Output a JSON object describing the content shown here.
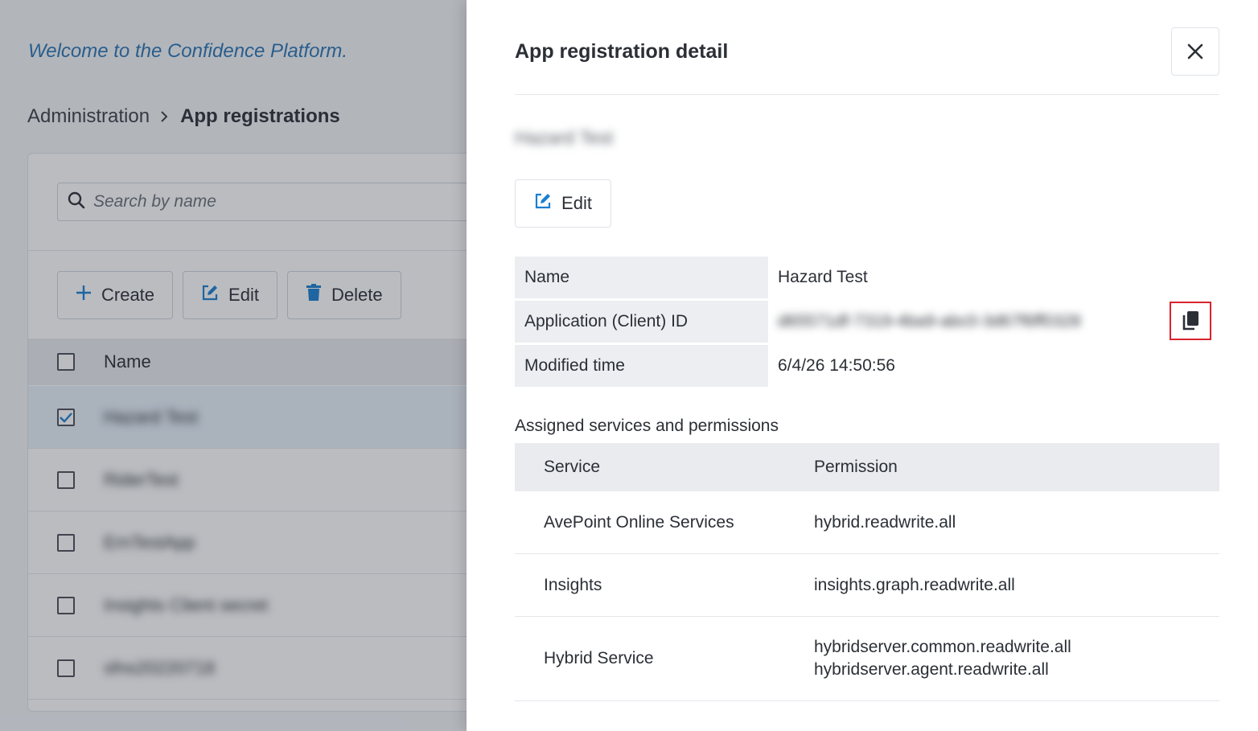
{
  "welcome": "Welcome to the Confidence Platform.",
  "breadcrumb": {
    "parent": "Administration",
    "current": "App registrations"
  },
  "search": {
    "placeholder": "Search by name"
  },
  "toolbar": {
    "create": "Create",
    "edit": "Edit",
    "delete": "Delete"
  },
  "list": {
    "header_name": "Name",
    "rows": [
      {
        "name": "Hazard Test",
        "checked": true
      },
      {
        "name": "RiderTest",
        "checked": false
      },
      {
        "name": "ErnTestApp",
        "checked": false
      },
      {
        "name": "Insights Client secret",
        "checked": false
      },
      {
        "name": "sfns20220718",
        "checked": false
      }
    ]
  },
  "drawer": {
    "title": "App registration detail",
    "app_name": "Hazard Test",
    "edit_label": "Edit",
    "props": {
      "name_label": "Name",
      "name_value": "Hazard Test",
      "client_id_label": "Application (Client) ID",
      "client_id_value": "d65571df-7319-4ba9-abc0-3d67f6ff0328",
      "modified_label": "Modified time",
      "modified_value": "6/4/26 14:50:56"
    },
    "services_title": "Assigned services and permissions",
    "services_table": {
      "header_service": "Service",
      "header_permission": "Permission",
      "rows": [
        {
          "service": "AvePoint Online Services",
          "permissions": [
            "hybrid.readwrite.all"
          ]
        },
        {
          "service": "Insights",
          "permissions": [
            "insights.graph.readwrite.all"
          ]
        },
        {
          "service": "Hybrid Service",
          "permissions": [
            "hybridserver.common.readwrite.all",
            "hybridserver.agent.readwrite.all"
          ]
        }
      ]
    }
  },
  "colors": {
    "accent": "#2c74b3",
    "highlight": "#d9232d",
    "icon_blue": "#1a7fd1"
  }
}
